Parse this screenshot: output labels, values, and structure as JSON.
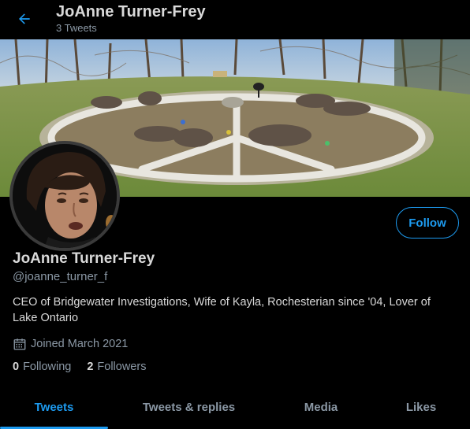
{
  "header": {
    "name": "JoAnne Turner-Frey",
    "tweet_count": "3 Tweets",
    "back_icon": "arrow-left-icon"
  },
  "banner": {
    "description_icon": "banner-image"
  },
  "profile": {
    "display_name": "JoAnne Turner-Frey",
    "handle": "@joanne_turner_f",
    "bio": "CEO of Bridgewater Investigations, Wife of Kayla, Rochesterian since '04, Lover of Lake Ontario",
    "joined": "Joined March 2021",
    "calendar_icon": "calendar-icon",
    "following_count": "0",
    "following_label": "Following",
    "followers_count": "2",
    "followers_label": "Followers",
    "follow_button": "Follow"
  },
  "tabs": [
    {
      "label": "Tweets",
      "active": true
    },
    {
      "label": "Tweets & replies",
      "active": false
    },
    {
      "label": "Media",
      "active": false
    },
    {
      "label": "Likes",
      "active": false
    }
  ],
  "colors": {
    "accent": "#1d9bf0",
    "background": "#000000",
    "secondary_text": "#8b98a5"
  }
}
